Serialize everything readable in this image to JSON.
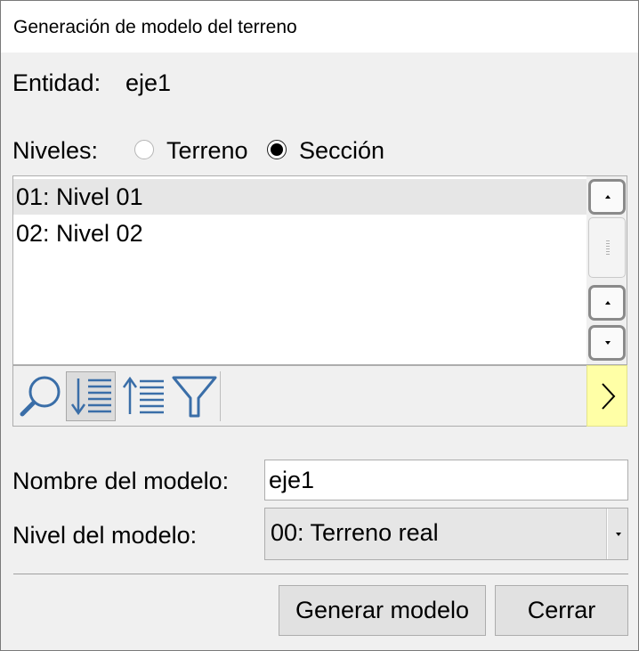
{
  "dialog": {
    "title": "Generación de modelo del terreno"
  },
  "entity": {
    "label": "Entidad:",
    "value": "eje1"
  },
  "levels": {
    "label": "Niveles:",
    "options": [
      {
        "label": "Terreno",
        "selected": false
      },
      {
        "label": "Sección",
        "selected": true
      }
    ],
    "items": [
      {
        "label": "01: Nivel 01",
        "selected": true
      },
      {
        "label": "02: Nivel 02",
        "selected": false
      }
    ]
  },
  "toolbar": {
    "icons": [
      "search-icon",
      "sort-descending-icon",
      "sort-ascending-icon",
      "filter-icon"
    ],
    "more_icon": "chevron-right-icon",
    "accent_color": "#3a6ea8",
    "more_bg": "#ffffa6"
  },
  "model": {
    "name_label": "Nombre del modelo:",
    "name_value": "eje1",
    "level_label": "Nivel del modelo:",
    "level_value": "00: Terreno real"
  },
  "buttons": {
    "generate": "Generar modelo",
    "close": "Cerrar"
  }
}
